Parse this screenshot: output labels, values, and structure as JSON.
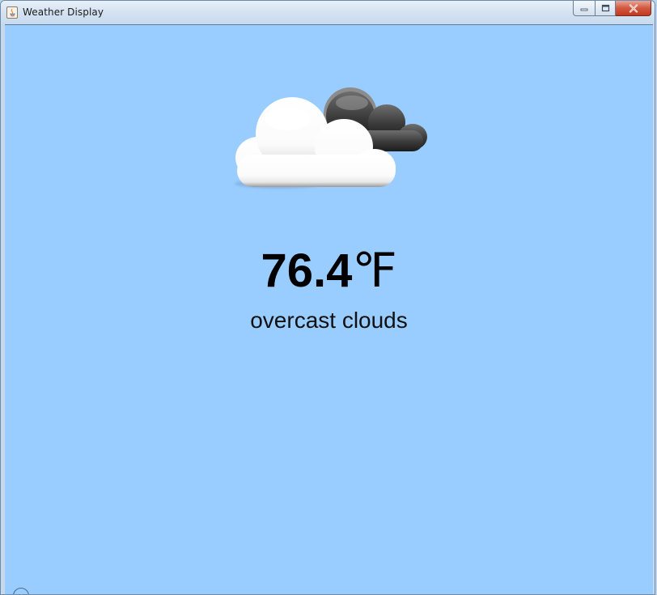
{
  "window": {
    "title": "Weather Display"
  },
  "titlebar": {
    "icons": [
      "java-app-icon",
      "minimize-icon",
      "maximize-icon",
      "close-icon"
    ]
  },
  "weather": {
    "icon": "overcast-clouds-icon",
    "temperature_value": "76.4",
    "temperature_unit": "℉",
    "description": "overcast clouds"
  },
  "colors": {
    "content_background": "#99ccff",
    "text": "#000000"
  }
}
